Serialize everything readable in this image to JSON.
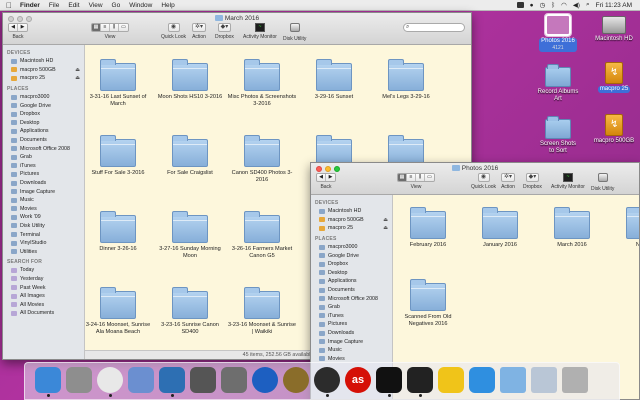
{
  "menubar": {
    "app": "Finder",
    "items": [
      "File",
      "Edit",
      "View",
      "Go",
      "Window",
      "Help"
    ],
    "clock": "Fri 11:23 AM"
  },
  "desktop": {
    "icons": [
      {
        "label": "Photos 2016",
        "sub": "4121",
        "type": "photo"
      },
      {
        "label": "Macintosh HD",
        "type": "hdd"
      },
      {
        "label": "Record Albums Art",
        "type": "folder"
      },
      {
        "label": "macpro 25",
        "type": "usb"
      },
      {
        "label": "Screen Shots to Sort",
        "type": "folder"
      },
      {
        "label": "macpro 500GB",
        "type": "usb"
      }
    ]
  },
  "toolbar": {
    "back": "Back",
    "view": "View",
    "quick_look": "Quick Look",
    "action": "Action",
    "dropbox": "Dropbox",
    "activity_monitor": "Activity Monitor",
    "disk_utility": "Disk Utility"
  },
  "window1": {
    "title": "March 2016",
    "status": "45 items, 252.56 GB available",
    "sidebar": {
      "devices_header": "DEVICES",
      "devices": [
        "Macintosh HD",
        "macpro 500GB",
        "macpro 25"
      ],
      "places_header": "PLACES",
      "places": [
        "macpro3000",
        "Google Drive",
        "Dropbox",
        "Desktop",
        "Applications",
        "Documents",
        "Microsoft Office 2008",
        "Grab",
        "iTunes",
        "Pictures",
        "Downloads",
        "Image Capture",
        "Music",
        "Movies",
        "Work '09",
        "Disk Utility",
        "Terminal",
        "VinylStudio",
        "Utilities"
      ],
      "search_header": "SEARCH FOR",
      "search": [
        "Today",
        "Yesterday",
        "Past Week",
        "All Images",
        "All Movies",
        "All Documents"
      ]
    },
    "folders": [
      "3-31-16 Last Sunset of March",
      "Moon Shots HS10 3-2016",
      "Misc Photos & Screenshots 3-2016",
      "3-29-16 Sunset",
      "Mel's Legs 3-29-16",
      "Stuff For Sale 3-2016",
      "For Sale Craigslist",
      "Canon SD400 Photos 3-2016",
      "",
      "",
      "Dinner 3-26-16",
      "3-27-16 Sunday Morning Moon",
      "3-26-16 Farmers Market Canon G5",
      "",
      "",
      "3-24-16 Moonset, Sunrise Ala Moana Beach",
      "3-23-16 Sunrise Canon SD400",
      "3-23-16 Moonset & Sunrise | Waikiki",
      "",
      ""
    ]
  },
  "window2": {
    "title": "Photos 2016",
    "sidebar": {
      "devices_header": "DEVICES",
      "devices": [
        "Macintosh HD",
        "macpro 500GB",
        "macpro 25"
      ],
      "places_header": "PLACES",
      "places": [
        "macpro3000",
        "Google Drive",
        "Dropbox",
        "Desktop",
        "Applications",
        "Documents",
        "Microsoft Office 2008",
        "Grab",
        "iTunes",
        "Pictures",
        "Downloads",
        "Image Capture",
        "Music",
        "Movies"
      ]
    },
    "folders": [
      "February 2016",
      "January 2016",
      "March 2016",
      "New A",
      "Scanned From Old Negatives 2016"
    ]
  },
  "dock": {
    "apps": [
      "finder-icon",
      "launchpad-icon",
      "chrome-icon",
      "photos-icon",
      "iphoto-icon",
      "aperture-icon",
      "image-capture-icon",
      "quicktime-icon",
      "compressor-icon",
      "dashboard-icon",
      "lastfm-icon",
      "activity-monitor-icon",
      "terminal-icon",
      "cyberduck-icon",
      "itunes-icon",
      "downloads-stack-icon",
      "documents-stack-icon",
      "trash-icon"
    ],
    "lastfm_glyph": "as"
  }
}
